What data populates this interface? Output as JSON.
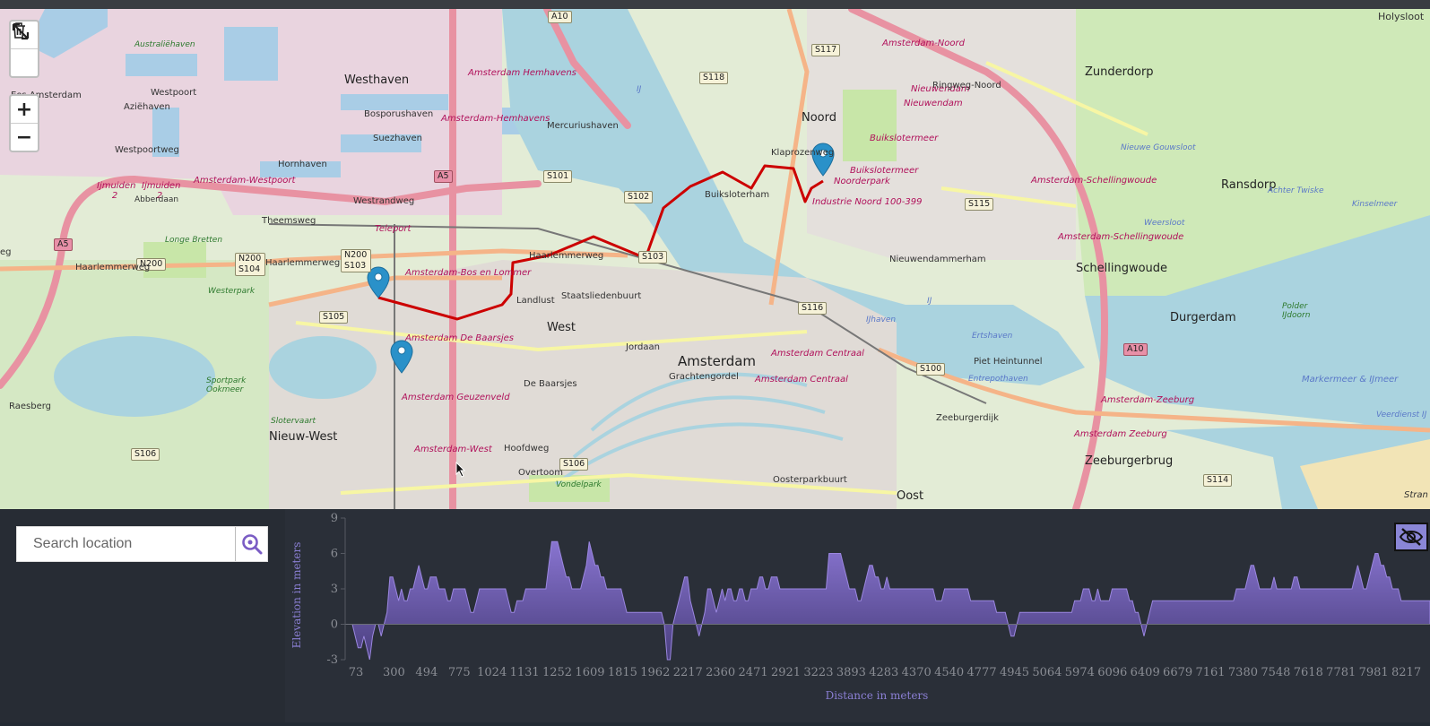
{
  "map": {
    "places": {
      "amsterdam": "Amsterdam",
      "noord": "Noord",
      "west": "West",
      "nieuw_west": "Nieuw-West",
      "oost": "Oost",
      "westhaven": "Westhaven",
      "zunderdorp": "Zunderdorp",
      "ransdorp": "Ransdorp",
      "schellingwoude": "Schellingwoude",
      "durgerdam": "Durgerdam",
      "zeeburgerbrug": "Zeeburgerbrug",
      "holysloot": "Holysloot",
      "raesberg": "Raesberg"
    },
    "stations": [
      "Amsterdam Hemhavens",
      "Amsterdam-Hemhavens",
      "Amsterdam-Westpoort",
      "Amsterdam-Bos en Lommer",
      "Amsterdam De Baarsjes",
      "Amsterdam Geuzenveld",
      "Amsterdam-West",
      "Amsterdam Centraal",
      "Amsterdam Centraal",
      "Amsterdam-Noord",
      "Nieuwendam",
      "Nieuwendam",
      "Buikslotermeer",
      "Buikslotermeer",
      "Amsterdam-Schellingwoude",
      "Amsterdam-Schellingwoude",
      "Amsterdam-Zeeburg",
      "Amsterdam Zeeburg",
      "Noorderpark",
      "Industrie Noord 100-399"
    ],
    "shields": [
      "A10",
      "S117",
      "S118",
      "S101",
      "S102",
      "S103",
      "S105",
      "S106",
      "S106",
      "S116",
      "S115",
      "S100",
      "S114",
      "A10",
      "A5",
      "A5",
      "N200",
      "N200 S103",
      "N200 S104"
    ],
    "streets": [
      "Westpoortweg",
      "Westrandweg",
      "Theemsweg",
      "Haarlemmerweg",
      "Haarlemmerweg",
      "Haarlemmerweg",
      "Ringweg-Noord",
      "Piet Heintunnel",
      "Zeeburgerdijk",
      "Overtoom",
      "Hoofdweg",
      "Teleport",
      "Klaprozenweg"
    ],
    "areas": [
      "Australiëhaven",
      "Westpoort",
      "Aziëhaven",
      "Bosporushaven",
      "Suezhaven",
      "Hornhaven",
      "Mercuriushaven",
      "Longe Bretten",
      "Sportpark Ookmeer",
      "Landlust",
      "Staatsliedenbuurt",
      "Jordaan",
      "Grachtengordel",
      "De Baarsjes",
      "Vondelpark",
      "Buiksloterham",
      "Nieuwendammerham",
      "Oosterparkbuurt",
      "Polder IJdoorn",
      "Slotervaart",
      "Westerpark"
    ],
    "waters": [
      "IJ",
      "IJ",
      "Nieuwe Gouwsloot",
      "Achter Twiske",
      "Kinselmeer",
      "Weersloot",
      "Markermeer & IJmeer",
      "Veerdienst IJ",
      "Entrepothaven",
      "Ertshaven",
      "IJhaven"
    ],
    "cut_labels": [
      "Eos Amsterdam Oost",
      "Ijmuiden 2",
      "Ijmuiden 2",
      "Abberdaan",
      "eg",
      "Stran"
    ]
  },
  "controls": {
    "fullscreen": "fullscreen-toggle",
    "delete": "trash",
    "zoom_in": "+",
    "zoom_out": "−"
  },
  "search": {
    "placeholder": "Search location"
  },
  "chart_data": {
    "type": "area",
    "xlabel": "Distance in meters",
    "ylabel": "Elevation in meters",
    "ylim": [
      -3,
      9
    ],
    "yticks": [
      -3,
      0,
      3,
      6,
      9
    ],
    "x_tick_labels": [
      "73",
      "300",
      "494",
      "775",
      "1024",
      "1131",
      "1252",
      "1609",
      "1815",
      "1962",
      "2217",
      "2360",
      "2471",
      "2921",
      "3223",
      "3893",
      "4283",
      "4370",
      "4540",
      "4777",
      "4945",
      "5064",
      "5974",
      "6096",
      "6409",
      "6679",
      "7161",
      "7380",
      "7548",
      "7618",
      "7781",
      "7981",
      "8217"
    ],
    "values": [
      0,
      -1,
      -2,
      -2,
      -1,
      -2,
      -3,
      -1,
      0,
      0,
      -1,
      0,
      1,
      4,
      4,
      3,
      2,
      3,
      2,
      2,
      3,
      3,
      4,
      5,
      4,
      3,
      3,
      4,
      4,
      4,
      3,
      3,
      3,
      2,
      2,
      3,
      3,
      3,
      3,
      3,
      2,
      1,
      1,
      2,
      3,
      3,
      3,
      3,
      3,
      3,
      3,
      3,
      3,
      3,
      2,
      1,
      1,
      2,
      2,
      2,
      3,
      3,
      3,
      3,
      3,
      3,
      3,
      3,
      5,
      7,
      7,
      7,
      6,
      5,
      4,
      4,
      3,
      3,
      3,
      3,
      4,
      5,
      7,
      6,
      5,
      5,
      4,
      4,
      3,
      3,
      3,
      3,
      3,
      3,
      2,
      1,
      1,
      1,
      1,
      1,
      1,
      1,
      1,
      1,
      1,
      1,
      1,
      1,
      0,
      -3,
      -3,
      0,
      1,
      2,
      3,
      4,
      4,
      2,
      1,
      0,
      -1,
      0,
      1,
      3,
      3,
      2,
      1,
      2,
      3,
      2,
      3,
      3,
      2,
      2,
      3,
      3,
      2,
      2,
      3,
      3,
      3,
      4,
      4,
      3,
      3,
      4,
      4,
      4,
      3,
      3,
      3,
      3,
      3,
      3,
      3,
      3,
      3,
      3,
      3,
      3,
      3,
      3,
      3,
      3,
      3,
      6,
      6,
      6,
      6,
      6,
      5,
      4,
      3,
      3,
      3,
      2,
      2,
      3,
      4,
      5,
      5,
      4,
      4,
      3,
      3,
      4,
      3,
      3,
      3,
      3,
      3,
      3,
      3,
      3,
      3,
      3,
      3,
      3,
      3,
      3,
      3,
      3,
      2,
      2,
      2,
      3,
      3,
      3,
      3,
      3,
      3,
      3,
      3,
      3,
      2,
      2,
      2,
      2,
      2,
      2,
      2,
      2,
      2,
      1,
      1,
      1,
      1,
      0,
      -1,
      -1,
      0,
      1,
      1,
      1,
      1,
      1,
      1,
      1,
      1,
      1,
      1,
      1,
      1,
      1,
      1,
      1,
      1,
      1,
      1,
      1,
      2,
      2,
      2,
      3,
      3,
      3,
      2,
      2,
      3,
      2,
      2,
      2,
      2,
      3,
      3,
      3,
      3,
      3,
      3,
      2,
      2,
      1,
      1,
      0,
      -1,
      0,
      1,
      2,
      2,
      2,
      2,
      2,
      2,
      2,
      2,
      2,
      2,
      2,
      2,
      2,
      2,
      2,
      2,
      2,
      2,
      2,
      2,
      2,
      2,
      2,
      2,
      2,
      2,
      2,
      2,
      2,
      3,
      3,
      3,
      3,
      4,
      5,
      5,
      4,
      3,
      3,
      3,
      3,
      3,
      4,
      3,
      3,
      3,
      3,
      3,
      3,
      4,
      4,
      3,
      3,
      3,
      3,
      3,
      3,
      3,
      3,
      3,
      3,
      3,
      3,
      3,
      3,
      3,
      3,
      3,
      3,
      3,
      4,
      5,
      4,
      3,
      3,
      4,
      5,
      6,
      6,
      5,
      5,
      4,
      4,
      3,
      3,
      3,
      2,
      2,
      2,
      2,
      2,
      2,
      2,
      2,
      2,
      2,
      2
    ]
  }
}
